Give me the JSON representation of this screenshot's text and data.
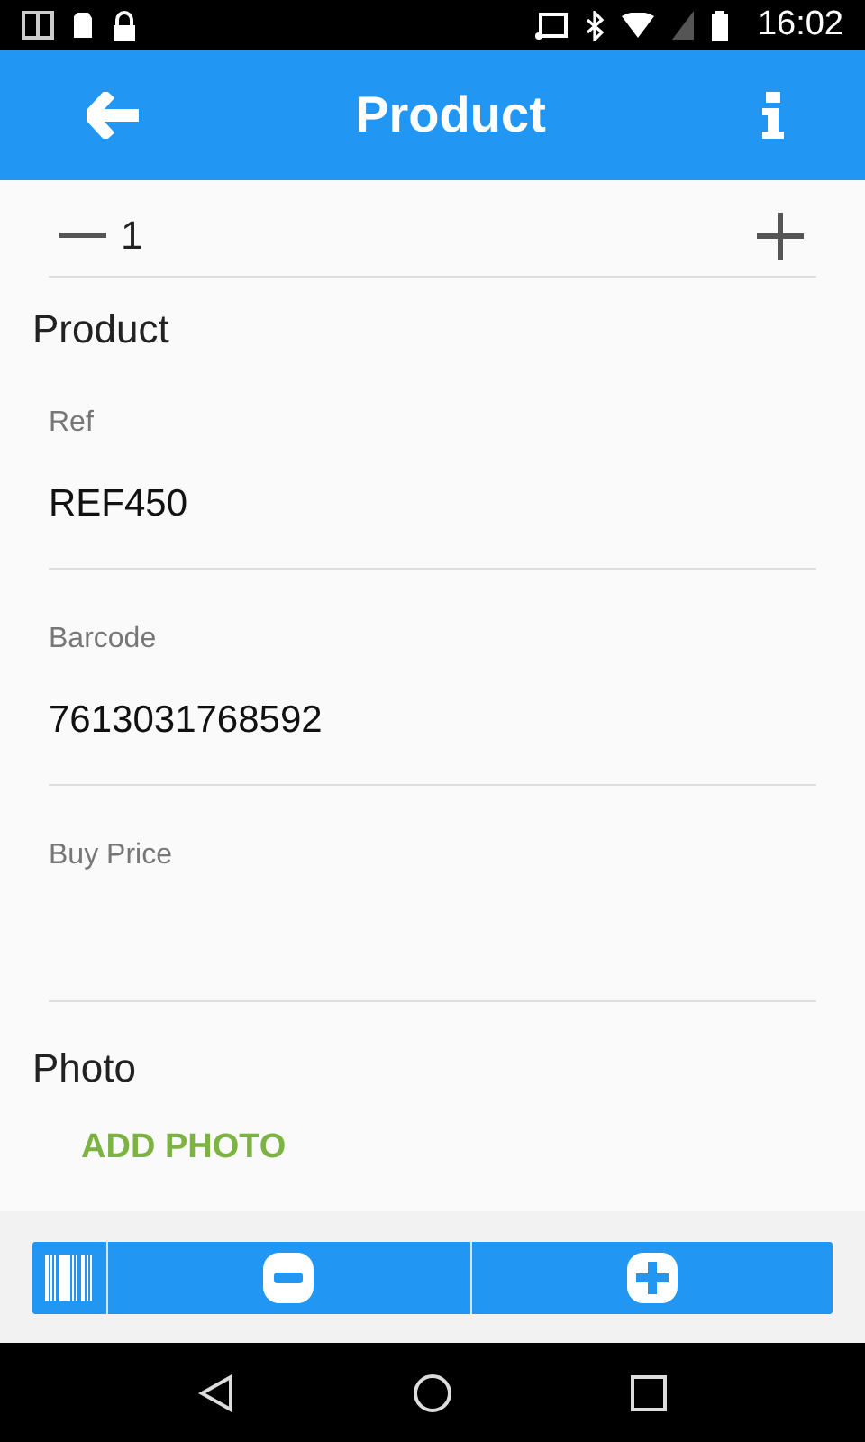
{
  "status_bar": {
    "time": "16:02"
  },
  "app_bar": {
    "title": "Product"
  },
  "quantity": {
    "value": "1"
  },
  "product_section": {
    "title": "Product",
    "fields": [
      {
        "label": "Ref",
        "value": "REF450"
      },
      {
        "label": "Barcode",
        "value": "7613031768592"
      },
      {
        "label": "Buy Price"
      }
    ]
  },
  "photo_section": {
    "title": "Photo",
    "button": "ADD PHOTO"
  }
}
